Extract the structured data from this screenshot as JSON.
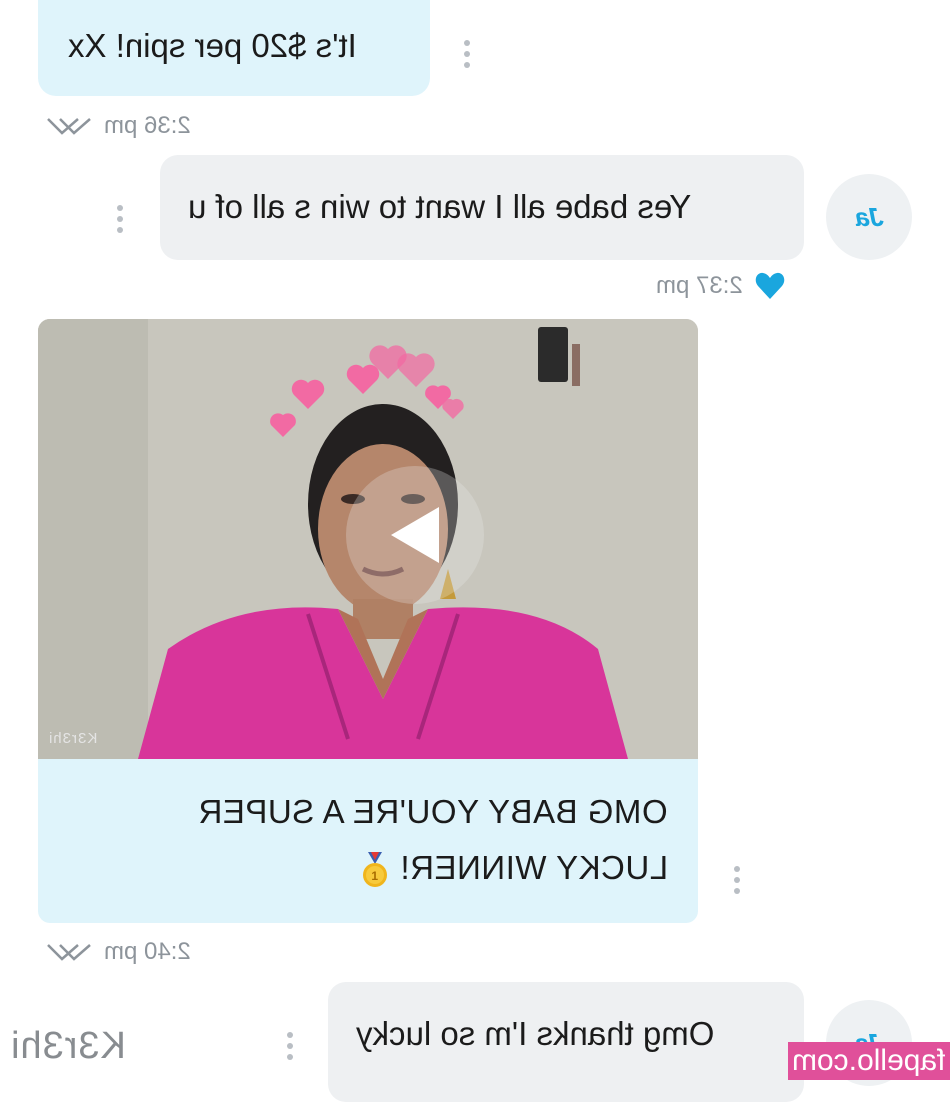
{
  "messages": {
    "m1": {
      "text": "It's $20 per spin! Xx",
      "time": "2:36 pm"
    },
    "m2": {
      "text": "Yes babe all I want to win s all of u",
      "time": "2:37 pm",
      "avatar": "Ja"
    },
    "m3": {
      "caption_line1": "OMG BABY YOU'RE A SUPER",
      "caption_line2": "LUCKY WINNER!",
      "caption_emoji": "1st-place-medal",
      "video_watermark": "K3r3hi",
      "time": "2:40 pm"
    },
    "m4": {
      "text": "Omg thanks I'm so lucky",
      "avatar": "Ja"
    }
  },
  "watermark": "K3r3hi",
  "site_badge": "fapello.com",
  "icons": {
    "read_status": "double-check-icon",
    "liked": "heart-icon",
    "menu": "kebab-menu-icon",
    "play": "play-icon"
  },
  "colors": {
    "sent_bubble": "#dff4fb",
    "received_bubble": "#eef0f2",
    "accent": "#1aa6de",
    "meta_text": "#8d949b",
    "badge": "#e0509a"
  }
}
